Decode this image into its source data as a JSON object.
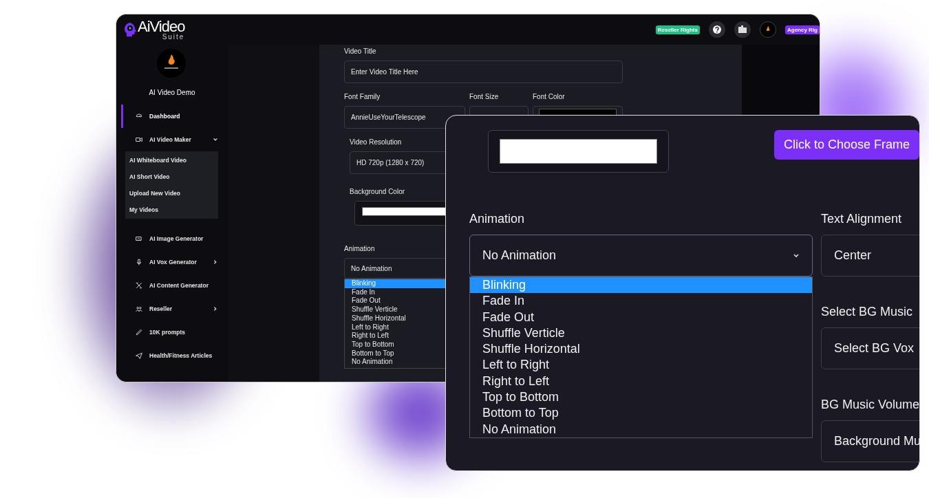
{
  "back_window": {
    "header": {
      "logo_text": "AiVideo",
      "logo_sub": "Suite",
      "badges": [
        {
          "label": "Reseller Rights",
          "color": "#1fbf86"
        },
        {
          "label": "Agency Rig",
          "color": "#7b2ff7"
        }
      ]
    },
    "sidebar": {
      "profile_name": "AI Video Demo",
      "items": [
        {
          "label": "Dashboard",
          "kind": "link",
          "selected": true
        },
        {
          "label": "AI Video Maker",
          "kind": "group",
          "selected": false,
          "expanded": true,
          "children": [
            {
              "label": "AI Whiteboard Video"
            },
            {
              "label": "AI Short Video"
            },
            {
              "label": "Upload New Video"
            },
            {
              "label": "My Videos"
            }
          ]
        },
        {
          "label": "AI Image Generator",
          "kind": "link",
          "selected": false
        },
        {
          "label": "AI Vox Generator",
          "kind": "group",
          "selected": false,
          "expanded": false
        },
        {
          "label": "AI Content Generator",
          "kind": "link",
          "selected": false
        },
        {
          "label": "Reseller",
          "kind": "group",
          "selected": false,
          "expanded": false
        },
        {
          "label": "10K prompts",
          "kind": "link",
          "selected": false
        },
        {
          "label": "Health/Fitness Articles",
          "kind": "link",
          "selected": false
        }
      ]
    },
    "form": {
      "video_title": {
        "label": "Video Title",
        "placeholder": "Enter Video Title Here"
      },
      "font_family": {
        "label": "Font Family",
        "value": "AnnieUseYourTelescope"
      },
      "font_size": {
        "label": "Font Size"
      },
      "font_color": {
        "label": "Font Color",
        "color": "#000000"
      },
      "video_resolution": {
        "label": "Video Resolution",
        "value": "HD 720p (1280 x 720)"
      },
      "background_color": {
        "label": "Background Color",
        "color": "#ffffff"
      },
      "animation": {
        "label": "Animation",
        "value": "No Animation",
        "options": [
          {
            "label": "Blinking",
            "highlighted": true
          },
          {
            "label": "Fade In",
            "highlighted": false
          },
          {
            "label": "Fade Out",
            "highlighted": false
          },
          {
            "label": "Shuffle Verticle",
            "highlighted": false
          },
          {
            "label": "Shuffle Horizontal",
            "highlighted": false
          },
          {
            "label": "Left to Right",
            "highlighted": false
          },
          {
            "label": "Right to Left",
            "highlighted": false
          },
          {
            "label": "Top to Bottom",
            "highlighted": false
          },
          {
            "label": "Bottom to Top",
            "highlighted": false
          },
          {
            "label": "No Animation",
            "highlighted": false
          }
        ]
      }
    }
  },
  "front_window": {
    "background_color": {
      "color": "#ffffff"
    },
    "frame_button": "Click to Choose Frame",
    "animation": {
      "label": "Animation",
      "value": "No Animation",
      "options": [
        {
          "label": "Blinking",
          "highlighted": true
        },
        {
          "label": "Fade In",
          "highlighted": false
        },
        {
          "label": "Fade Out",
          "highlighted": false
        },
        {
          "label": "Shuffle Verticle",
          "highlighted": false
        },
        {
          "label": "Shuffle Horizontal",
          "highlighted": false
        },
        {
          "label": "Left to Right",
          "highlighted": false
        },
        {
          "label": "Right to Left",
          "highlighted": false
        },
        {
          "label": "Top to Bottom",
          "highlighted": false
        },
        {
          "label": "Bottom to Top",
          "highlighted": false
        },
        {
          "label": "No Animation",
          "highlighted": false
        }
      ]
    },
    "text_alignment": {
      "label": "Text Alignment",
      "value": "Center"
    },
    "bg_music": {
      "label": "Select BG Music",
      "value": "Select BG Vox"
    },
    "bg_music_volume": {
      "label": "BG Music Volume",
      "value": "Background Mu"
    }
  }
}
